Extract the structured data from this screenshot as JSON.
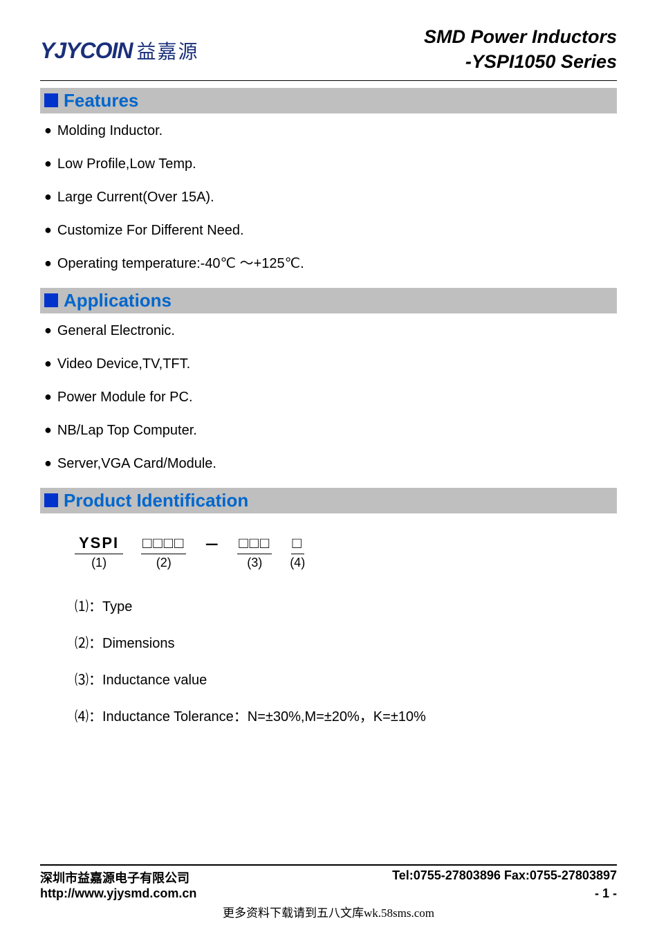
{
  "logo": {
    "text": "YJYCOIN",
    "cn": "益嘉源"
  },
  "title": {
    "line1": "SMD Power Inductors",
    "line2": "-YSPI1050 Series"
  },
  "sections": {
    "features": {
      "title": "Features",
      "items": [
        "Molding Inductor.",
        "Low Profile,Low Temp.",
        "Large Current(Over 15A).",
        "Customize For Different Need.",
        "Operating temperature:-40℃ ～+125℃."
      ]
    },
    "applications": {
      "title": "Applications",
      "items": [
        "General Electronic.",
        "Video Device,TV,TFT.",
        "Power Module for PC.",
        "NB/Lap Top Computer.",
        "Server,VGA Card/Module."
      ]
    },
    "productId": {
      "title": "Product Identification",
      "parts": {
        "p1_top": "YSPI",
        "p1_num": "(1)",
        "p2_top": "□□□□",
        "p2_num": "(2)",
        "dash": "－",
        "p3_top": "□□□",
        "p3_num": "(3)",
        "p4_top": "□",
        "p4_num": "(4)"
      },
      "defs": [
        "⑴：Type",
        "⑵：Dimensions",
        "⑶：Inductance value",
        "⑷：Inductance Tolerance：N=±30%,M=±20%，K=±10%"
      ]
    }
  },
  "footer": {
    "company": "深圳市益嘉源电子有限公司",
    "contact": "Tel:0755-27803896   Fax:0755-27803897",
    "url": "http://www.yjysmd.com.cn",
    "page": "- 1 -",
    "bottom": "更多资料下载请到五八文库wk.58sms.com"
  }
}
